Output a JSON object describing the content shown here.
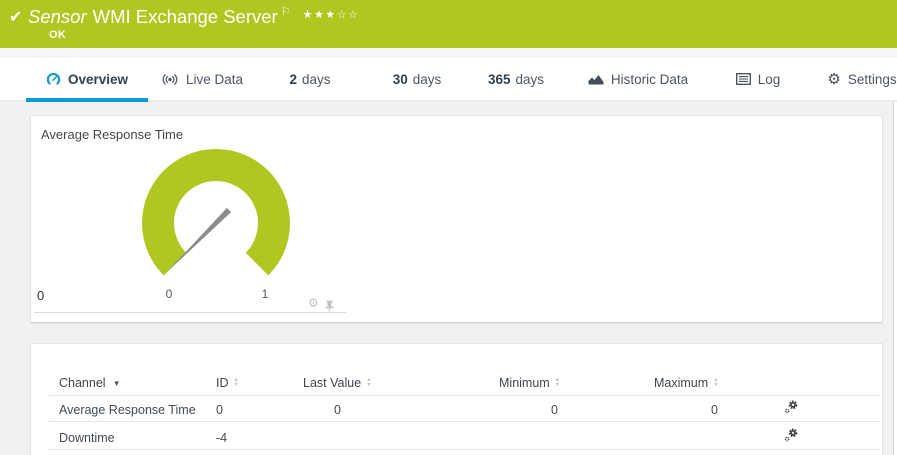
{
  "header": {
    "title_prefix": "Sensor",
    "title": "WMI Exchange Server",
    "status": "OK",
    "colors": {
      "bar_green": "#b1c620",
      "active_tab_blue": "#0e9bd8"
    }
  },
  "icons": {
    "check": "✔",
    "flag": "⚐",
    "stars": "★★★☆☆",
    "gear": "⚙",
    "mini_gear": "⚙",
    "sort_asc": "▲",
    "sort_desc": "▼",
    "channel_sort_desc": "▼"
  },
  "tabs": {
    "overview": {
      "label": "Overview"
    },
    "live_data": {
      "label": "Live Data"
    },
    "days2": {
      "num": "2",
      "label": "days"
    },
    "days30": {
      "num": "30",
      "label": "days"
    },
    "days365": {
      "num": "365",
      "label": "days"
    },
    "historic": {
      "label": "Historic Data"
    },
    "log": {
      "label": "Log"
    },
    "settings": {
      "label": "Settings"
    }
  },
  "gauge_panel": {
    "title": "Average Response Time",
    "scale_start": "0",
    "scale_end": "1",
    "axis_label": "0",
    "needle_value": 0,
    "gauge_color": "#b1c620"
  },
  "channel_table": {
    "columns": {
      "channel": "Channel",
      "id": "ID",
      "last_value": "Last Value",
      "minimum": "Minimum",
      "maximum": "Maximum"
    },
    "rows": [
      {
        "channel": "Average Response Time",
        "id": "0",
        "last_value": "0",
        "minimum": "0",
        "maximum": "0"
      },
      {
        "channel": "Downtime",
        "id": "-4",
        "last_value": "",
        "minimum": "",
        "maximum": ""
      }
    ]
  }
}
